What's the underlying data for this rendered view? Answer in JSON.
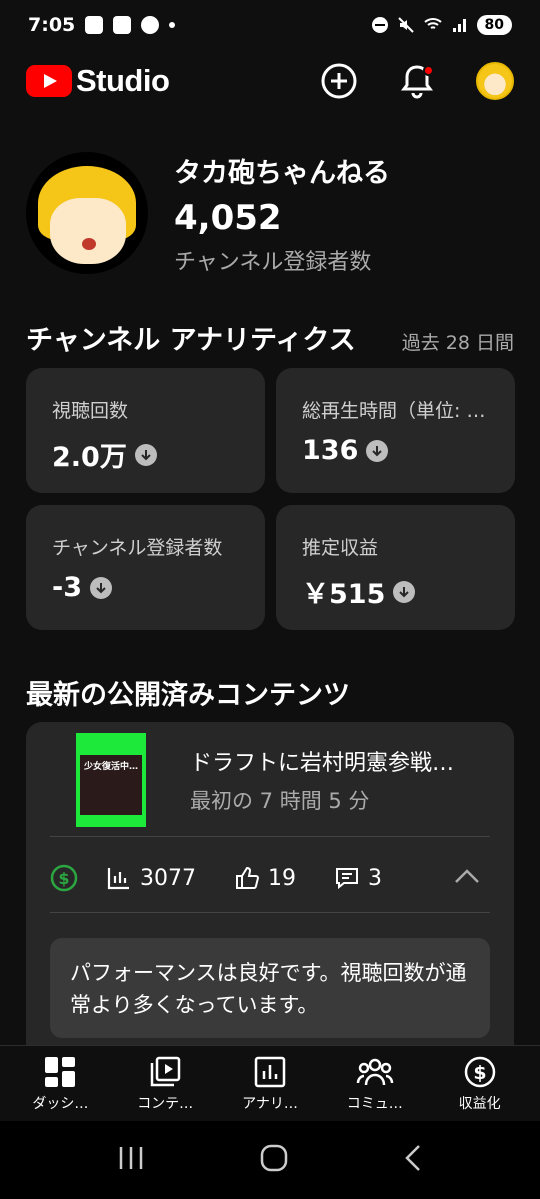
{
  "status_bar": {
    "time": "7:05",
    "battery": "80"
  },
  "app": {
    "title": "Studio"
  },
  "channel": {
    "name": "タカ砲ちゃんねる",
    "subscribers": "4,052",
    "subscribers_label": "チャンネル登録者数"
  },
  "analytics": {
    "title": "チャンネル アナリティクス",
    "period": "過去 28 日間",
    "metrics": [
      {
        "label": "視聴回数",
        "value": "2.0万",
        "trend": "down"
      },
      {
        "label": "総再生時間（単位: …",
        "value": "136",
        "trend": "down"
      },
      {
        "label": "チャンネル登録者数",
        "value": "-3",
        "trend": "down"
      },
      {
        "label": "推定収益",
        "value": "￥515",
        "trend": "down"
      }
    ]
  },
  "latest": {
    "title": "最新の公開済みコンテンツ",
    "video": {
      "thumb_text": "少女復活中…",
      "title": "ドラフトに岩村明憲参戦…",
      "meta": "最初の 7 時間 5 分",
      "views": "3077",
      "likes": "19",
      "comments": "3"
    },
    "performance": "パフォーマンスは良好です。視聴回数が通常より多くなっています。"
  },
  "nav": [
    {
      "label": "ダッシ…",
      "icon": "dashboard-icon"
    },
    {
      "label": "コンテ…",
      "icon": "content-icon"
    },
    {
      "label": "アナリ…",
      "icon": "analytics-icon"
    },
    {
      "label": "コミュ…",
      "icon": "community-icon"
    },
    {
      "label": "収益化",
      "icon": "earn-icon"
    }
  ],
  "colors": {
    "brand": "#ff0000",
    "background": "#0f0f0f",
    "card": "#272727",
    "monetization": "#2ba640"
  }
}
